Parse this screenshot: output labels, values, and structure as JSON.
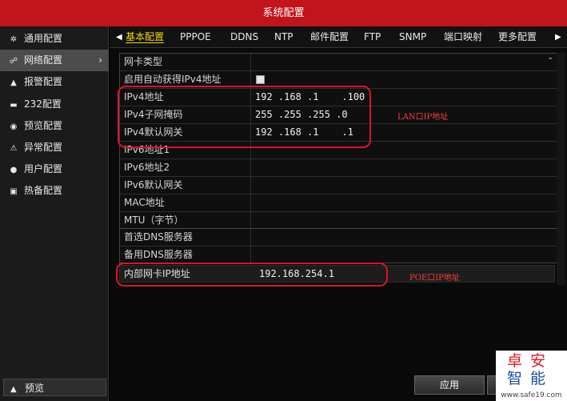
{
  "window": {
    "title": "系统配置"
  },
  "sidebar": {
    "items": [
      {
        "label": "通用配置",
        "icon": "gear-icon"
      },
      {
        "label": "网络配置",
        "icon": "network-icon",
        "active": true
      },
      {
        "label": "报警配置",
        "icon": "alarm-icon"
      },
      {
        "label": "232配置",
        "icon": "serial-icon"
      },
      {
        "label": "预览配置",
        "icon": "eye-icon"
      },
      {
        "label": "异常配置",
        "icon": "warning-icon"
      },
      {
        "label": "用户配置",
        "icon": "users-icon"
      },
      {
        "label": "热备配置",
        "icon": "hotspare-icon"
      }
    ],
    "preview_label": "预览"
  },
  "tabs": [
    "基本配置",
    "PPPOE",
    "DDNS",
    "NTP",
    "邮件配置",
    "FTP",
    "SNMP",
    "端口映射",
    "更多配置"
  ],
  "form": {
    "nic_type": {
      "label": "网卡类型",
      "value": ""
    },
    "dhcp": {
      "label": "启用自动获得IPv4地址",
      "checked": false
    },
    "ipv4_address": {
      "label": "IPv4地址",
      "value": "192 .168 .1    .100"
    },
    "ipv4_mask": {
      "label": "IPv4子网掩码",
      "value": "255 .255 .255 .0"
    },
    "ipv4_gateway": {
      "label": "IPv4默认网关",
      "value": "192 .168 .1    .1"
    },
    "ipv6_address1": {
      "label": "IPv6地址1",
      "value": ""
    },
    "ipv6_address2": {
      "label": "IPv6地址2",
      "value": ""
    },
    "ipv6_gateway": {
      "label": "IPv6默认网关",
      "value": ""
    },
    "mac": {
      "label": "MAC地址",
      "value": ""
    },
    "mtu": {
      "label": "MTU（字节）",
      "value": ""
    },
    "dns_primary": {
      "label": "首选DNS服务器",
      "value": ""
    },
    "dns_secondary": {
      "label": "备用DNS服务器",
      "value": ""
    },
    "internal_nic": {
      "label": "内部网卡IP地址",
      "value": "192.168.254.1"
    }
  },
  "annotations": {
    "lan": "LAN口IP地址",
    "poe": "POE口IP地址"
  },
  "buttons": {
    "apply": "应用"
  },
  "watermark": {
    "line1": "卓安",
    "line2": "智能",
    "url": "www.safe19.com"
  },
  "colors": {
    "title_bar": "#c2141b",
    "active_tab": "#f5d800",
    "annotation": "#e0102a"
  }
}
